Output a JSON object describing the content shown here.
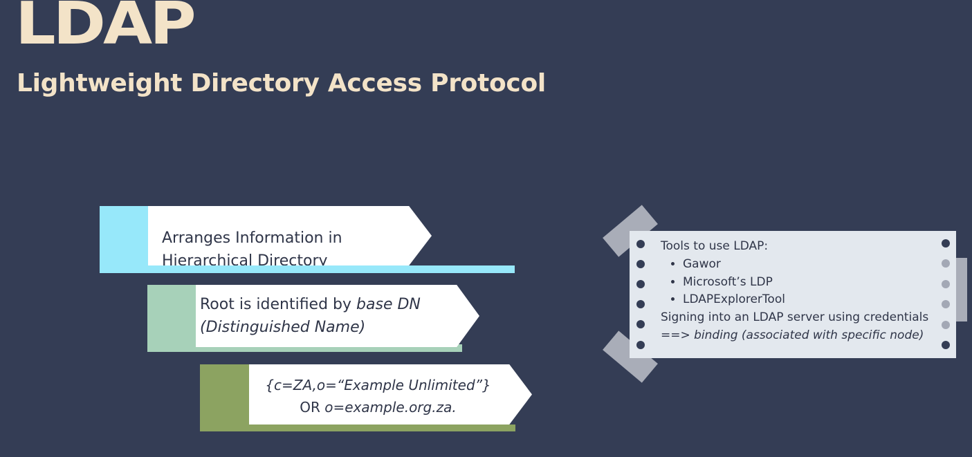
{
  "slide": {
    "title": "LDAP",
    "subtitle": "Lightweight Directory Access Protocol"
  },
  "cards": [
    {
      "text": "Arranges Information in Hierarchical Directory",
      "accent_color": "#97e8fa"
    },
    {
      "text_plain": "Root is identified by ",
      "text_italic": "base DN (Distinguished Name)",
      "accent_color": "#a7d1b9"
    },
    {
      "line1": "{c=ZA,o=“Example Unlimited”}",
      "line2_plain": "OR ",
      "line2_italic": "o=example.org.za.",
      "accent_color": "#8ca361"
    }
  ],
  "note": {
    "heading": "Tools to use LDAP:",
    "tools": [
      "Gawor",
      "Microsoft’s LDP",
      "LDAPExplorerTool"
    ],
    "line1": "Signing into an LDAP server using credentials",
    "line2_plain": "==> ",
    "line2_italic": "binding (associated with specific node)"
  },
  "colors": {
    "background": "#343d55",
    "title_color": "#f3e3c8",
    "note_background": "#e3e8ee"
  }
}
